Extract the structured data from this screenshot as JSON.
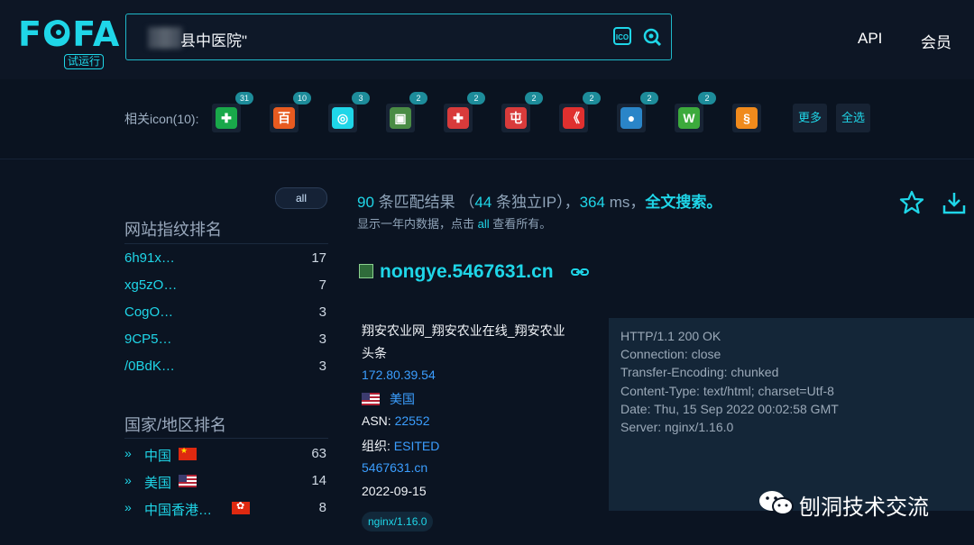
{
  "header": {
    "logo_text": "FOFA",
    "logo_badge": "试运行",
    "search_value": "县中医院\"",
    "ico_label": "ICO",
    "nav": [
      "API",
      "会员"
    ]
  },
  "iconbar": {
    "label": "相关icon(10):",
    "icons": [
      {
        "name": "favicon-1",
        "count": "31",
        "glyph": "✚",
        "color": "#19a84a"
      },
      {
        "name": "favicon-2",
        "count": "10",
        "glyph": "百",
        "color": "#e85b20"
      },
      {
        "name": "favicon-3",
        "count": "3",
        "glyph": "◎",
        "color": "#1fd6e8"
      },
      {
        "name": "favicon-4",
        "count": "2",
        "glyph": "▣",
        "color": "#4a8c45"
      },
      {
        "name": "favicon-5",
        "count": "2",
        "glyph": "✚",
        "color": "#d83b3b"
      },
      {
        "name": "favicon-6",
        "count": "2",
        "glyph": "屯",
        "color": "#d83b3b"
      },
      {
        "name": "favicon-7",
        "count": "2",
        "glyph": "《",
        "color": "#e0302f"
      },
      {
        "name": "favicon-8",
        "count": "2",
        "glyph": "●",
        "color": "#2a85c8"
      },
      {
        "name": "favicon-9",
        "count": "2",
        "glyph": "W",
        "color": "#3caa3c"
      },
      {
        "name": "favicon-10",
        "count": "",
        "glyph": "§",
        "color": "#f08a1c"
      }
    ],
    "more_label": "更多",
    "select_all_label": "全选"
  },
  "sidebar": {
    "all_label": "all",
    "fingerprint_title": "网站指纹排名",
    "fingerprints": [
      {
        "name": "6h91x…",
        "count": "17"
      },
      {
        "name": "xg5zO…",
        "count": "7"
      },
      {
        "name": "CogO…",
        "count": "3"
      },
      {
        "name": "9CP5…",
        "count": "3"
      },
      {
        "name": "/0BdK…",
        "count": "3"
      }
    ],
    "country_title": "国家/地区排名",
    "countries": [
      {
        "name": "中国",
        "count": "63",
        "flag": "cn"
      },
      {
        "name": "美国",
        "count": "14",
        "flag": "us"
      },
      {
        "name": "中国香港…",
        "count": "8",
        "flag": "hk"
      }
    ]
  },
  "results": {
    "matches": "90",
    "matches_suffix": " 条匹配结果 （",
    "unique_ip": "44",
    "unique_suffix": " 条独立IP）",
    "sep": "，",
    "time": "364",
    "time_unit": " ms，",
    "fulltext": "全文搜索。",
    "note_prefix": "显示一年内数据，点击 ",
    "note_link": "all",
    "note_suffix": " 查看所有。"
  },
  "result_item": {
    "host": "nongye.5467631.cn",
    "title_line1": "翔安农业网_翔安农业在线_翔安农业",
    "title_line2": "头条",
    "ip": "172.80.39.54",
    "country": "美国",
    "asn_label": "ASN: ",
    "asn": "22552",
    "org_label": "组织: ",
    "org": "ESITED",
    "domain": "5467631.cn",
    "date": "2022-09-15",
    "tag": "nginx/1.16.0",
    "http_lines": [
      "HTTP/1.1 200 OK",
      "Connection: close",
      "Transfer-Encoding: chunked",
      "Content-Type: text/html; charset=Utf-8",
      "Date: Thu, 15 Sep 2022 00:02:58 GMT",
      "Server: nginx/1.16.0"
    ]
  },
  "watermark": {
    "text": "刨洞技术交流"
  }
}
